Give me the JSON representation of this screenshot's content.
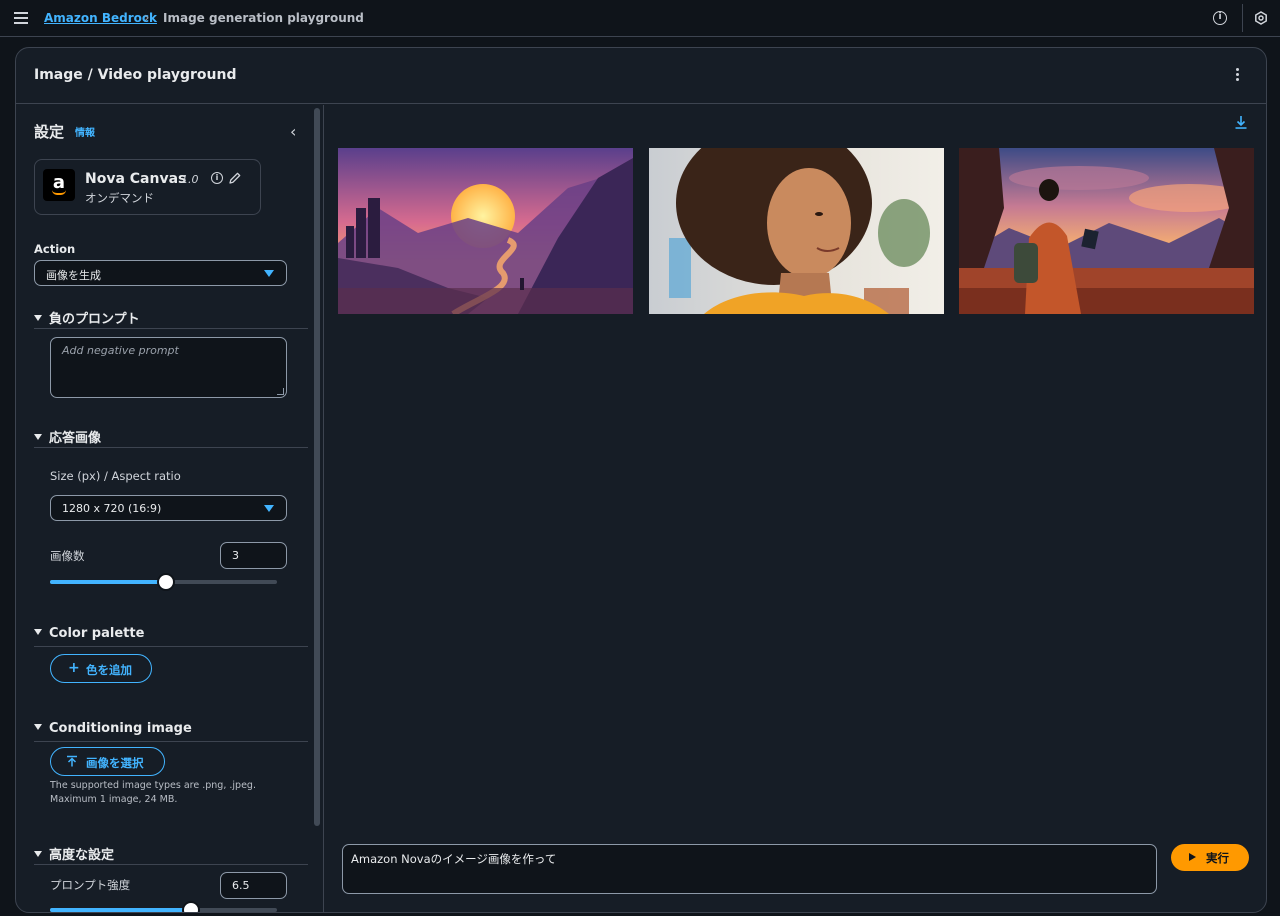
{
  "topbar": {
    "breadcrumb_root": "Amazon Bedrock",
    "breadcrumb_current": "Image generation playground"
  },
  "container": {
    "title": "Image / Video playground"
  },
  "settings": {
    "title": "設定",
    "info_link": "情報",
    "model": {
      "name": "Nova Canvas",
      "version": "1.0",
      "mode": "オンデマンド",
      "logo_letter": "a"
    },
    "action_label": "Action",
    "action_value": "画像を生成",
    "negative_prompt": {
      "heading": "負のプロンプト",
      "placeholder": "Add negative prompt"
    },
    "response_image": {
      "heading": "応答画像",
      "size_label": "Size (px) / Aspect ratio",
      "size_value": "1280 x 720 (16:9)",
      "count_label": "画像数",
      "count_value": "3",
      "count_slider_fraction": 0.51
    },
    "color_palette": {
      "heading": "Color palette",
      "add_button": "色を追加"
    },
    "conditioning_image": {
      "heading": "Conditioning image",
      "select_button": "画像を選択",
      "hint_line1": "The supported image types are .png, .jpeg.",
      "hint_line2": "Maximum 1 image, 24 MB."
    },
    "advanced": {
      "heading": "高度な設定",
      "strength_label": "プロンプト強度",
      "strength_value": "6.5",
      "strength_slider_fraction": 0.62
    }
  },
  "main": {
    "prompt_text": "Amazon Novaのイメージ画像を作って",
    "run_button": "実行"
  },
  "colors": {
    "accent": "#42b4ff",
    "run": "#ff9900",
    "background": "#0f141a",
    "panel": "#161d26"
  }
}
